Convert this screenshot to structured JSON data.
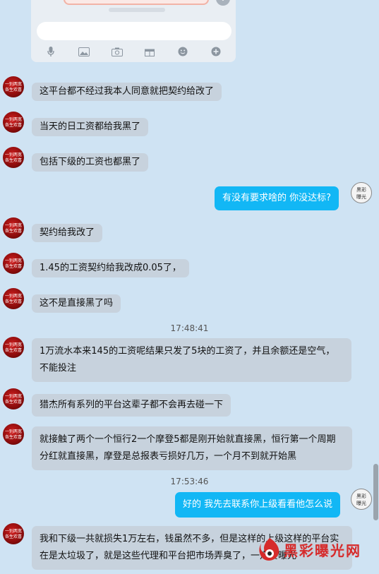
{
  "quoted_screenshot": {
    "tools": [
      "mic-icon",
      "image-icon",
      "camera-icon",
      "gift-icon",
      "emoji-icon",
      "plus-icon"
    ]
  },
  "messages": [
    {
      "side": "them",
      "text": "这平台都不经过我本人同意就把契约给改了"
    },
    {
      "side": "them",
      "text": "当天的日工资都给我黑了"
    },
    {
      "side": "them",
      "text": "包括下级的工资也都黑了"
    },
    {
      "side": "me",
      "text": "有没有要求啥的 你没达标?"
    },
    {
      "side": "them",
      "text": "契约给我改了"
    },
    {
      "side": "them",
      "text": "1.45的工资契约给我改成0.05了，"
    },
    {
      "side": "them",
      "text": "这不是直接黑了吗"
    },
    {
      "side": "them",
      "text": "1万流水本来145的工资呢结果只发了5块的工资了，并且余额还是空气，不能投注"
    },
    {
      "side": "them",
      "text": "猎杰所有系列的平台这辈子都不会再去碰一下"
    },
    {
      "side": "them",
      "text": "就接触了两个一个恒行2一个摩登5都是刚开始就直接黑，恒行第一个周期分红就直接黑，摩登是总报表亏损好几万，一个月不到就开始黑"
    },
    {
      "side": "me",
      "text": "好的  我先去联系你上级看看他怎么说"
    },
    {
      "side": "them",
      "text": "我和下级一共就损失1万左右，钱虽然不多，但是这样的上级这样的平台实在是太垃圾了，就是这些代理和平台把市场弄臭了，一定要曝光"
    }
  ],
  "timestamps": [
    "17:48:41",
    "17:53:46"
  ],
  "avatar_text": {
    "them": "一别两宽 各生欢喜",
    "me": "黑彩曝光"
  },
  "watermark": {
    "text": "黑彩曝光网"
  },
  "colors": {
    "background": "#cfe3f3",
    "them_bubble": "#c7d2dd",
    "me_bubble": "#12b7f5",
    "watermark": "#d62b2b"
  }
}
